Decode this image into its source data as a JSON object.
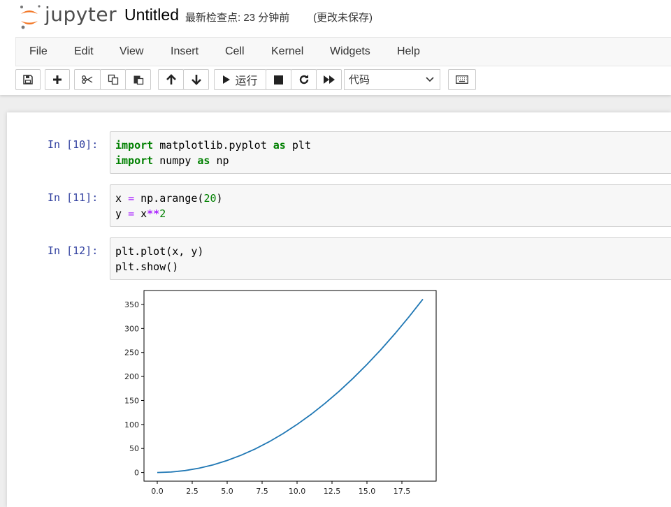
{
  "header": {
    "logo_text": "jupyter",
    "notebook_name": "Untitled",
    "checkpoint": "最新检查点: 23 分钟前",
    "autosave_status": "(更改未保存)"
  },
  "menu": [
    "File",
    "Edit",
    "View",
    "Insert",
    "Cell",
    "Kernel",
    "Widgets",
    "Help"
  ],
  "toolbar": {
    "icons": [
      "save-icon",
      "plus-icon",
      "cut-icon",
      "copy-icon",
      "paste-icon",
      "arrow-up-icon",
      "arrow-down-icon",
      "play-icon",
      "stop-icon",
      "restart-icon",
      "fast-forward-icon",
      "keyboard-icon"
    ],
    "run_label": "运行",
    "cell_type": "代码"
  },
  "cells": [
    {
      "prompt": "In [10]:",
      "lines": [
        "import matplotlib.pyplot as plt",
        "import numpy as np"
      ]
    },
    {
      "prompt": "In [11]:",
      "lines": [
        "x = np.arange(20)",
        "y = x**2"
      ]
    },
    {
      "prompt": "In [12]:",
      "lines": [
        "plt.plot(x, y)",
        "plt.show()"
      ]
    }
  ],
  "chart_data": {
    "type": "line",
    "x": [
      0,
      1,
      2,
      3,
      4,
      5,
      6,
      7,
      8,
      9,
      10,
      11,
      12,
      13,
      14,
      15,
      16,
      17,
      18,
      19
    ],
    "series": [
      {
        "values": [
          0,
          1,
          4,
          9,
          16,
          25,
          36,
          49,
          64,
          81,
          100,
          121,
          144,
          169,
          196,
          225,
          256,
          289,
          324,
          361
        ],
        "color": "#1f77b4"
      }
    ],
    "xticks": [
      "0.0",
      "2.5",
      "5.0",
      "7.5",
      "10.0",
      "12.5",
      "15.0",
      "17.5"
    ],
    "yticks": [
      "0",
      "50",
      "100",
      "150",
      "200",
      "250",
      "300",
      "350"
    ],
    "xlim": [
      -0.95,
      19.95
    ],
    "ylim": [
      -18.05,
      379.05
    ],
    "grid": false,
    "title": "",
    "xlabel": "",
    "ylabel": ""
  }
}
